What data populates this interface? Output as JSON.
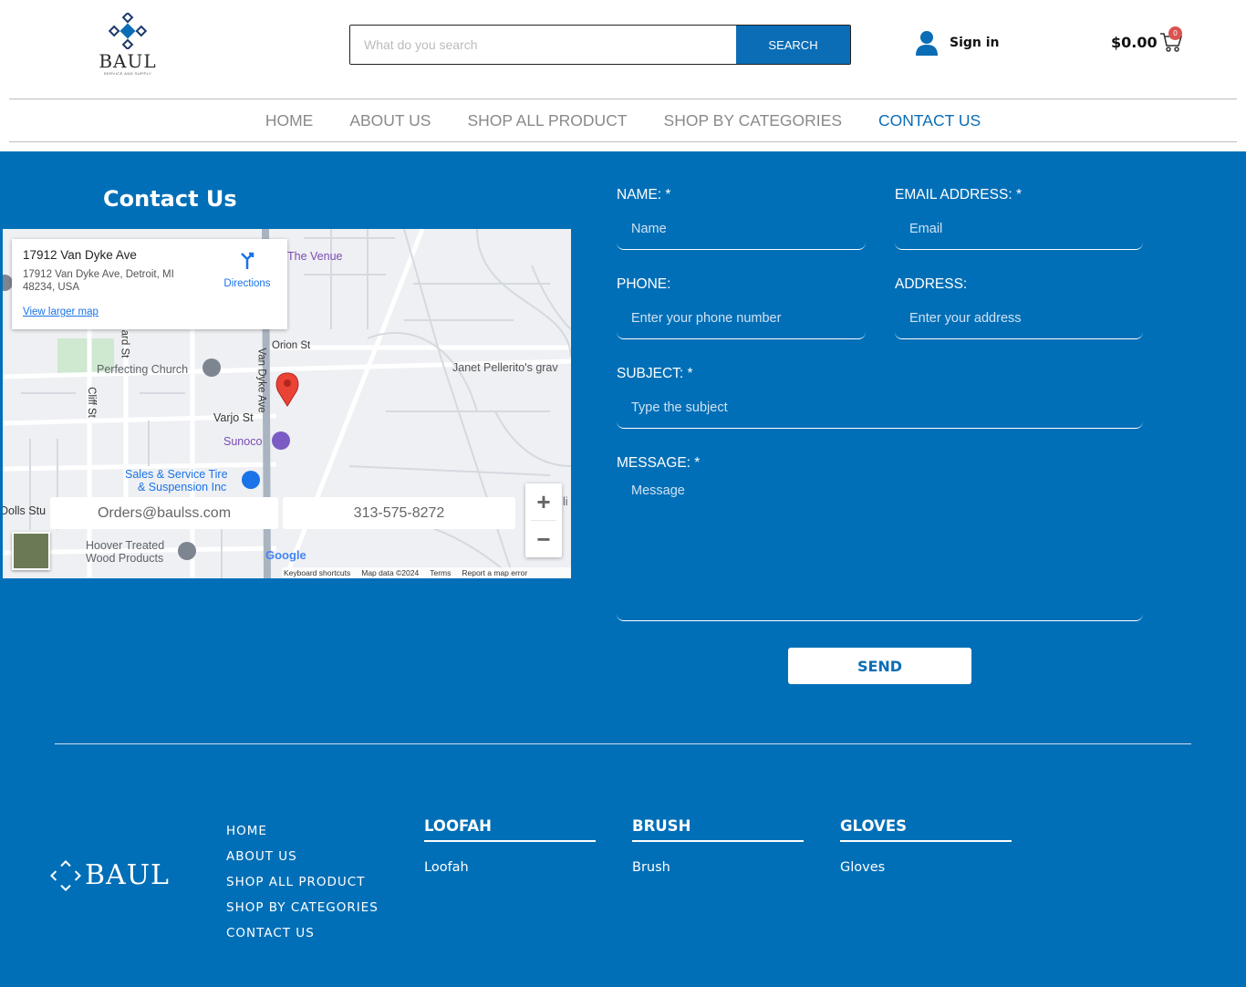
{
  "brand": {
    "name": "BAUL",
    "tagline": "SERVICE AND SUPPLY"
  },
  "search": {
    "placeholder": "What do you search",
    "button_label": "SEARCH"
  },
  "account": {
    "signin_label": "Sign in"
  },
  "cart": {
    "amount": "$0.00",
    "count": "0"
  },
  "nav": {
    "items": [
      "HOME",
      "ABOUT US",
      "SHOP ALL PRODUCT",
      "SHOP BY CATEGORIES",
      "CONTACT US"
    ],
    "active": "CONTACT US"
  },
  "contact": {
    "title": "Contact Us"
  },
  "map": {
    "place_title": "17912 Van Dyke Ave",
    "place_address": "17912 Van Dyke Ave, Detroit, MI 48234, USA",
    "larger_map_link": "View larger map",
    "directions_label": "Directions",
    "labels": {
      "the_venue": "The Venue",
      "orion_st": "Orion St",
      "perfecting_church": "Perfecting Church",
      "janet": "Janet Pellerito's grav",
      "varjo_st": "Varjo St",
      "sunoco": "Sunoco",
      "sales_service_1": "Sales & Service Tire",
      "sales_service_2": "& Suspension Inc",
      "dolls": "Dolls Stu",
      "hoover_1": "Hoover Treated",
      "hoover_2": "Wood Products",
      "cliff_st": "Cliff St",
      "ward_st": "ard St",
      "van_dyke_ave": "Van Dyke Ave",
      "li": "li"
    },
    "email_tab": "Orders@baulss.com",
    "phone_tab": "313-575-8272",
    "google": "Google",
    "footer": [
      "Keyboard shortcuts",
      "Map data ©2024",
      "Terms",
      "Report a map error"
    ],
    "zoom_in": "+",
    "zoom_out": "−"
  },
  "form": {
    "name_label": "NAME:  *",
    "name_placeholder": "Name",
    "email_label": "EMAIL ADDRESS:  *",
    "email_placeholder": "Email",
    "phone_label": "PHONE:",
    "phone_placeholder": "Enter your phone number",
    "address_label": "ADDRESS:",
    "address_placeholder": "Enter your address",
    "subject_label": "SUBJECT:  *",
    "subject_placeholder": "Type the subject",
    "message_label": "MESSAGE:  *",
    "message_placeholder": "Message",
    "send_label": "SEND"
  },
  "footer": {
    "nav": [
      "HOME",
      "ABOUT US",
      "SHOP ALL PRODUCT",
      "SHOP BY CATEGORIES",
      "CONTACT US"
    ],
    "columns": [
      {
        "heading": "LOOFAH",
        "link": "Loofah"
      },
      {
        "heading": "BRUSH",
        "link": "Brush"
      },
      {
        "heading": "GLOVES",
        "link": "Gloves"
      }
    ]
  },
  "colors": {
    "primary": "#016fb7",
    "accent": "#0b6db5",
    "badge": "#d9534f"
  }
}
